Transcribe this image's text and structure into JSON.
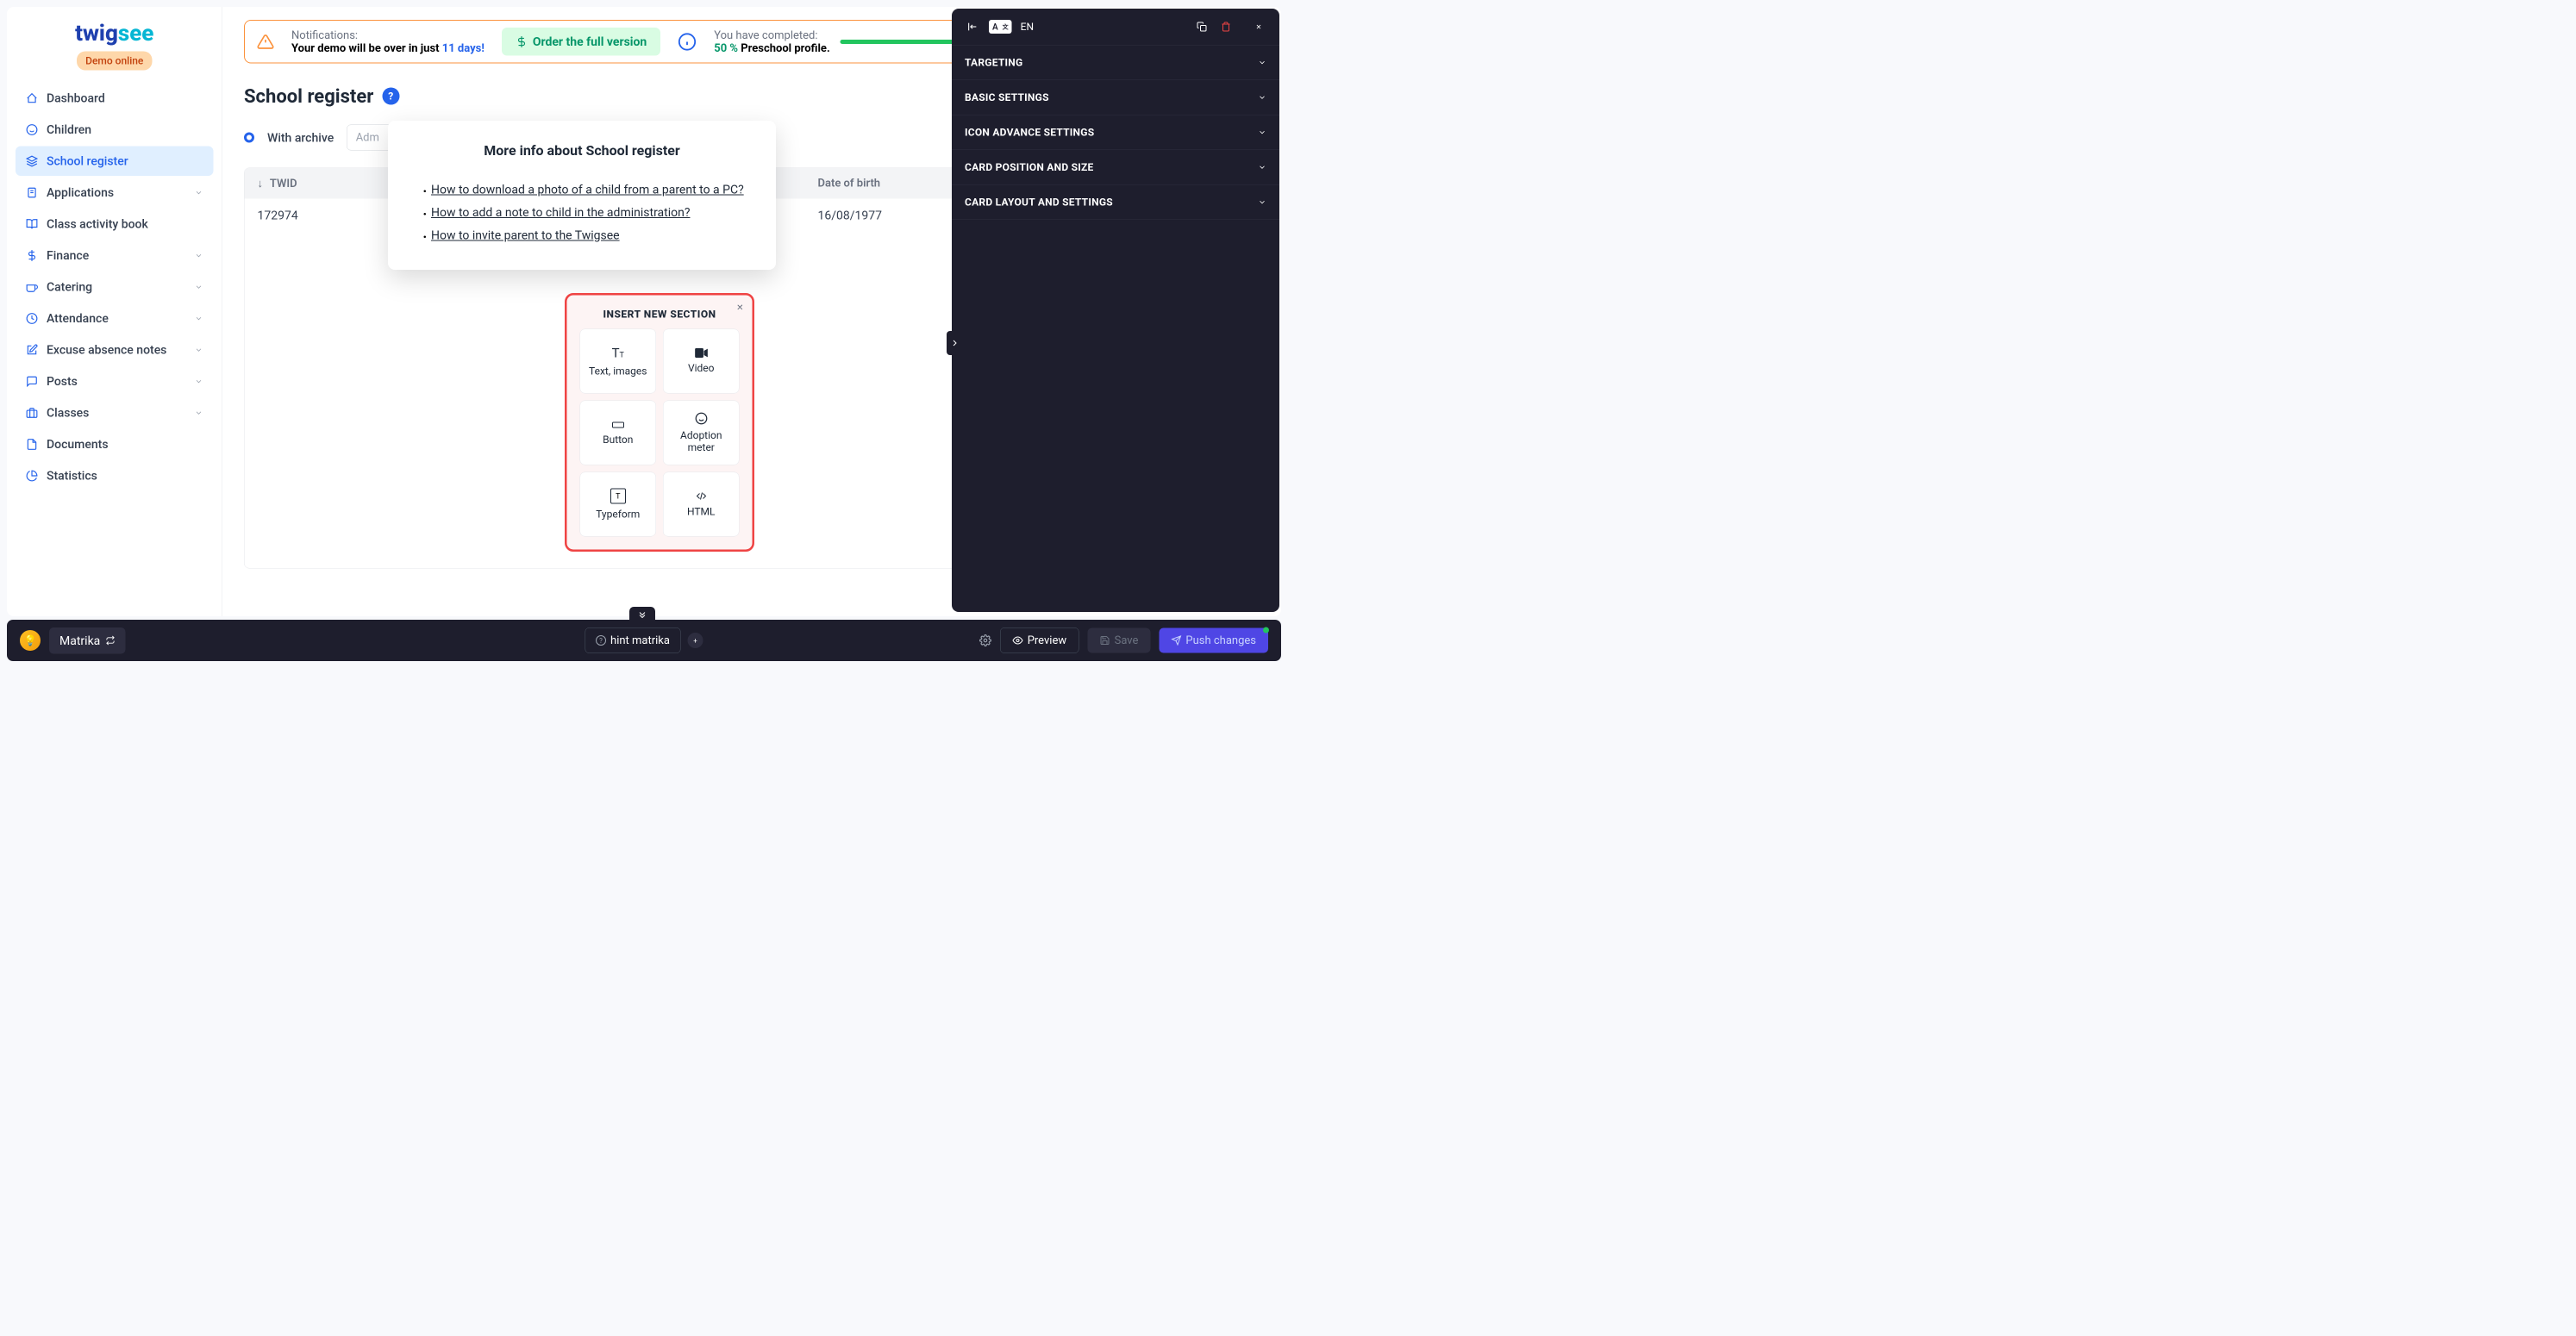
{
  "logo": {
    "part1": "twig",
    "part2": "see"
  },
  "demo_badge": "Demo online",
  "nav": {
    "dashboard": "Dashboard",
    "children": "Children",
    "school_register": "School register",
    "applications": "Applications",
    "class_activity": "Class activity book",
    "finance": "Finance",
    "catering": "Catering",
    "attendance": "Attendance",
    "excuse": "Excuse absence notes",
    "posts": "Posts",
    "classes": "Classes",
    "documents": "Documents",
    "statistics": "Statistics"
  },
  "notifications": {
    "label": "Notifications:",
    "text_prefix": "Your demo will be over in just ",
    "days": "11 days!",
    "order_btn": "Order the full version",
    "completed_label": "You have completed:",
    "completed_pct": "50 %",
    "completed_item": "Preschool profile.",
    "progress_pct": 50
  },
  "page": {
    "title": "School register",
    "filter_label": "With archive",
    "input_placeholder": "Adm"
  },
  "table": {
    "col_twid": "TWID",
    "col_dob": "Date of birth",
    "row": {
      "twid": "172974",
      "dob": "16/08/1977"
    }
  },
  "popover": {
    "title": "More info about School register",
    "links": [
      "How to download a photo of a child from a parent to a PC?",
      "How to add a note to child in the administration?",
      "How to invite parent to the Twigsee"
    ]
  },
  "insert_panel": {
    "title": "INSERT NEW SECTION",
    "cards": {
      "text_images": "Text, images",
      "video": "Video",
      "button": "Button",
      "adoption": "Adoption meter",
      "typeform": "Typeform",
      "html": "HTML"
    }
  },
  "right_panel": {
    "lang": "EN",
    "sections": [
      "TARGETING",
      "BASIC SETTINGS",
      "ICON ADVANCE SETTINGS",
      "CARD POSITION AND SIZE",
      "CARD LAYOUT AND SETTINGS"
    ]
  },
  "bottom_bar": {
    "matrika": "Matrika",
    "hint": "hint matrika",
    "preview": "Preview",
    "save": "Save",
    "push": "Push changes"
  }
}
